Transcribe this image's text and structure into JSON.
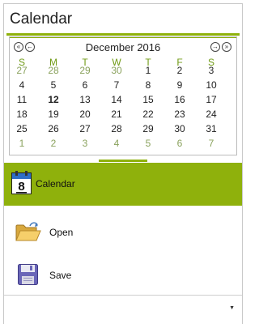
{
  "panel": {
    "title": "Calendar"
  },
  "calendar": {
    "month_label": "December 2016",
    "weekdays": [
      "S",
      "M",
      "T",
      "W",
      "T",
      "F",
      "S"
    ],
    "weeks": [
      [
        {
          "d": "27",
          "o": true
        },
        {
          "d": "28",
          "o": true
        },
        {
          "d": "29",
          "o": true
        },
        {
          "d": "30",
          "o": true
        },
        {
          "d": "1"
        },
        {
          "d": "2"
        },
        {
          "d": "3"
        }
      ],
      [
        {
          "d": "4"
        },
        {
          "d": "5"
        },
        {
          "d": "6"
        },
        {
          "d": "7"
        },
        {
          "d": "8"
        },
        {
          "d": "9"
        },
        {
          "d": "10"
        }
      ],
      [
        {
          "d": "11"
        },
        {
          "d": "12",
          "today": true
        },
        {
          "d": "13"
        },
        {
          "d": "14"
        },
        {
          "d": "15"
        },
        {
          "d": "16"
        },
        {
          "d": "17"
        }
      ],
      [
        {
          "d": "18"
        },
        {
          "d": "19"
        },
        {
          "d": "20"
        },
        {
          "d": "21"
        },
        {
          "d": "22"
        },
        {
          "d": "23"
        },
        {
          "d": "24"
        }
      ],
      [
        {
          "d": "25"
        },
        {
          "d": "26"
        },
        {
          "d": "27"
        },
        {
          "d": "28"
        },
        {
          "d": "29"
        },
        {
          "d": "30"
        },
        {
          "d": "31"
        }
      ],
      [
        {
          "d": "1",
          "o": true
        },
        {
          "d": "2",
          "o": true
        },
        {
          "d": "3",
          "o": true
        },
        {
          "d": "4",
          "o": true
        },
        {
          "d": "5",
          "o": true
        },
        {
          "d": "6",
          "o": true
        },
        {
          "d": "7",
          "o": true
        }
      ]
    ],
    "nav_icons": {
      "prev_year": "double-left-arrow-icon",
      "prev_month": "left-arrow-icon",
      "next_month": "right-arrow-icon",
      "next_year": "double-right-arrow-icon"
    }
  },
  "nav_items": [
    {
      "label": "Calendar",
      "icon": "calendar-icon",
      "selected": true
    },
    {
      "label": "Open",
      "icon": "folder-open-icon"
    },
    {
      "label": "Save",
      "icon": "floppy-disk-icon"
    }
  ],
  "calendar_icon_text": "8",
  "colors": {
    "accent": "#8fb10c",
    "other_month_day": "#8aa25d"
  }
}
